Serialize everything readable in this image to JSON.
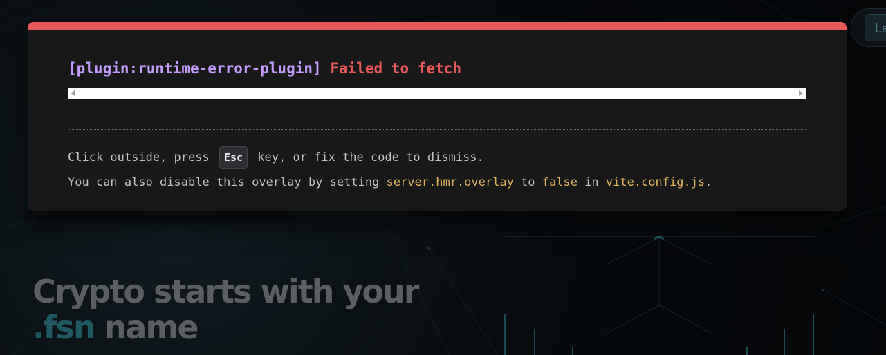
{
  "page": {
    "header": {
      "launch_button_label": "La"
    },
    "hero": {
      "title_line1": "Crypto starts with your",
      "title_accent": ".fsn",
      "title_line2_rest": " name"
    }
  },
  "error_overlay": {
    "plugin_tag": "[plugin:runtime-error-plugin]",
    "message": "Failed to fetch",
    "tip_line1": {
      "before": "Click outside, press ",
      "key": "Esc",
      "after": " key, or fix the code to dismiss."
    },
    "tip_line2": {
      "t1": "You can also disable this overlay by setting ",
      "code1": "server.hmr.overlay",
      "t2": " to ",
      "code2": "false",
      "t3": " in ",
      "code3": "vite.config.js",
      "t4": "."
    }
  },
  "colors": {
    "overlay_accent": "#e85a5a",
    "plugin_tag": "#c49cff",
    "code_highlight": "#e2b55a",
    "hero_accent": "#1f5a63"
  },
  "icons": [
    "scroll-left-arrow-icon",
    "scroll-right-arrow-icon"
  ]
}
